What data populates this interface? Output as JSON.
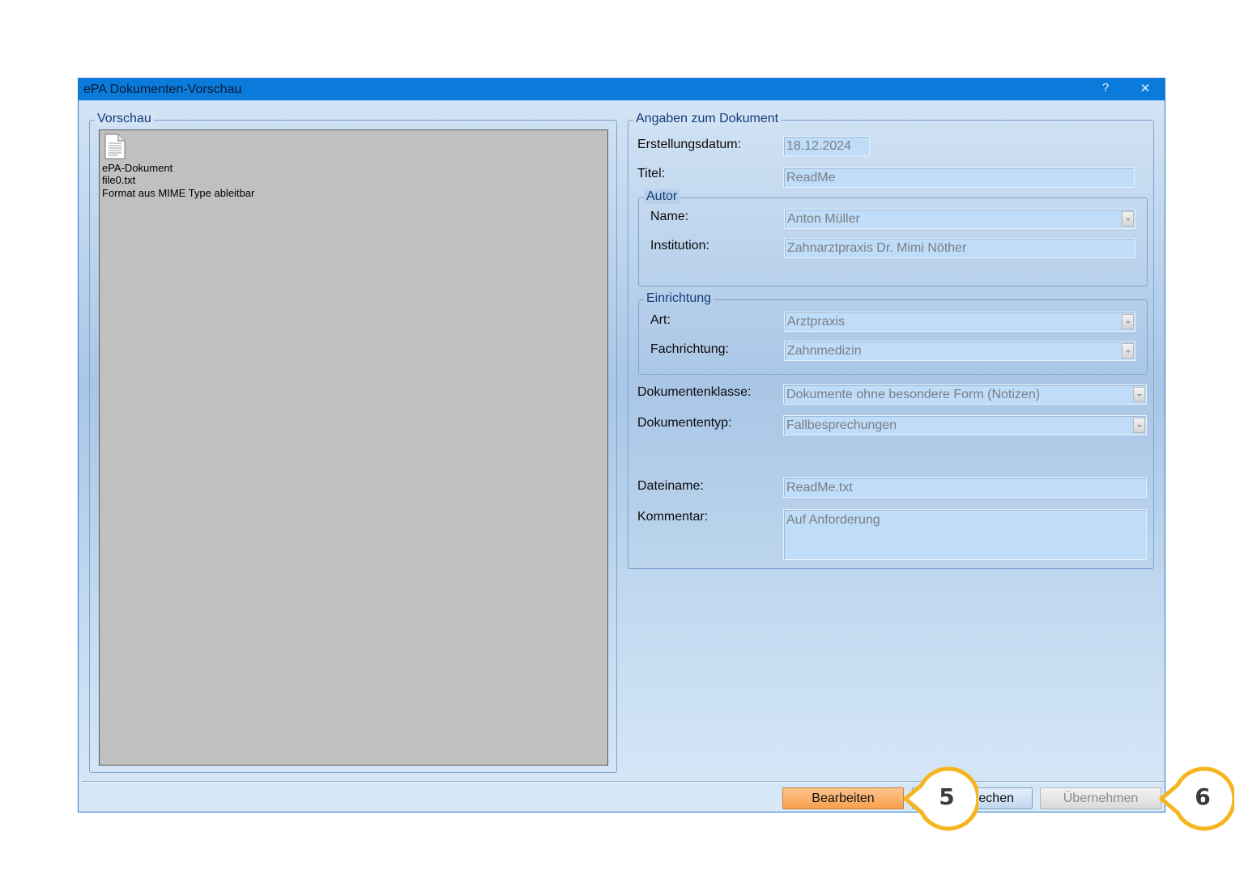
{
  "window": {
    "title": "ePA Dokumenten-Vorschau",
    "help_glyph": "?",
    "close_glyph": "✕"
  },
  "preview": {
    "legend": "Vorschau",
    "icon": "text-file-icon",
    "lines": [
      "ePA-Dokument",
      "file0.txt",
      "Format aus MIME Type ableitbar"
    ]
  },
  "details": {
    "legend": "Angaben zum Dokument",
    "erstellungsdatum": {
      "label": "Erstellungsdatum:",
      "value": "18.12.2024"
    },
    "titel": {
      "label": "Titel:",
      "value": "ReadMe"
    },
    "autor": {
      "legend": "Autor",
      "name": {
        "label": "Name:",
        "value": "Anton Müller"
      },
      "institution": {
        "label": "Institution:",
        "value": "Zahnarztpraxis Dr. Mimi Nöther"
      }
    },
    "einrichtung": {
      "legend": "Einrichtung",
      "art": {
        "label": "Art:",
        "value": "Arztpraxis"
      },
      "fachrichtung": {
        "label": "Fachrichtung:",
        "value": "Zahnmedizin"
      }
    },
    "dokumentenklasse": {
      "label": "Dokumentenklasse:",
      "value": "Dokumente ohne besondere Form (Notizen)"
    },
    "dokumententyp": {
      "label": "Dokumententyp:",
      "value": "Fallbesprechungen"
    },
    "dateiname": {
      "label": "Dateiname:",
      "value": "ReadMe.txt"
    },
    "kommentar": {
      "label": "Kommentar:",
      "value": "Auf Anforderung"
    }
  },
  "buttons": {
    "bearbeiten": "Bearbeiten",
    "abbrechen_visible": "echen",
    "uebernehmen": "Übernehmen"
  },
  "callouts": [
    "5",
    "6"
  ],
  "colors": {
    "titlebar": "#0b7bdb",
    "callout_ring": "#f6b51e",
    "primary_button": "#f7a04f"
  }
}
